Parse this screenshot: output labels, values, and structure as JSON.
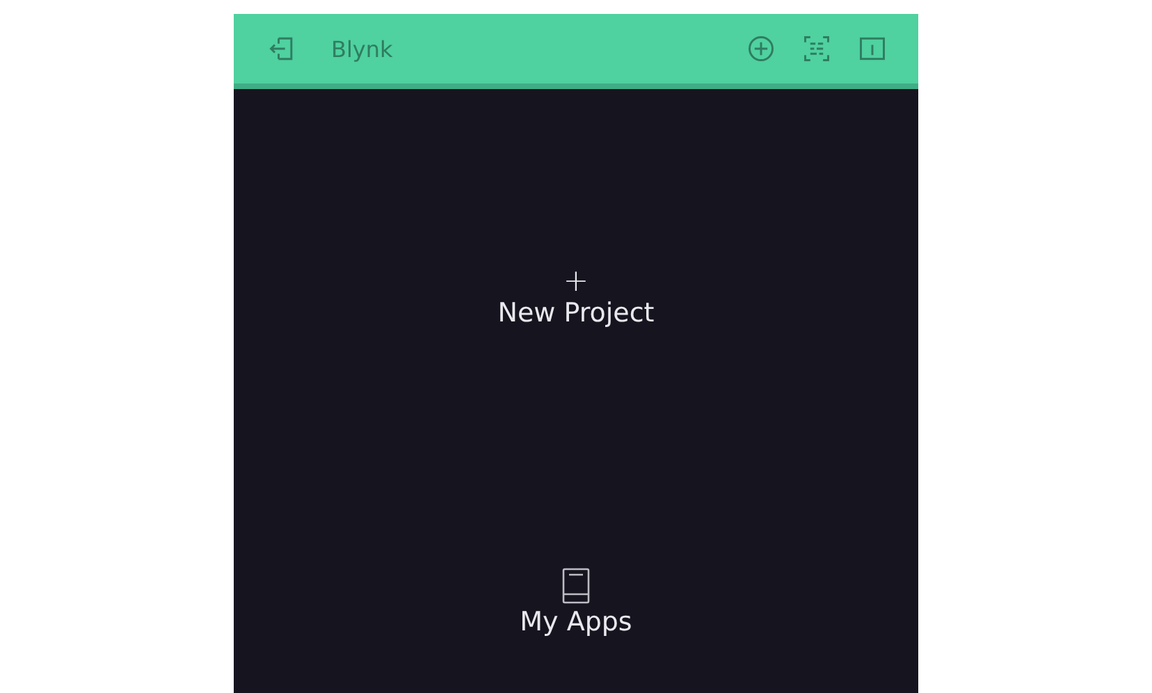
{
  "app_bar": {
    "title": "Blynk"
  },
  "actions": [
    {
      "kind": "new-project",
      "icon": "+",
      "label": "New Project"
    },
    {
      "kind": "my-apps",
      "label": "My Apps"
    }
  ]
}
